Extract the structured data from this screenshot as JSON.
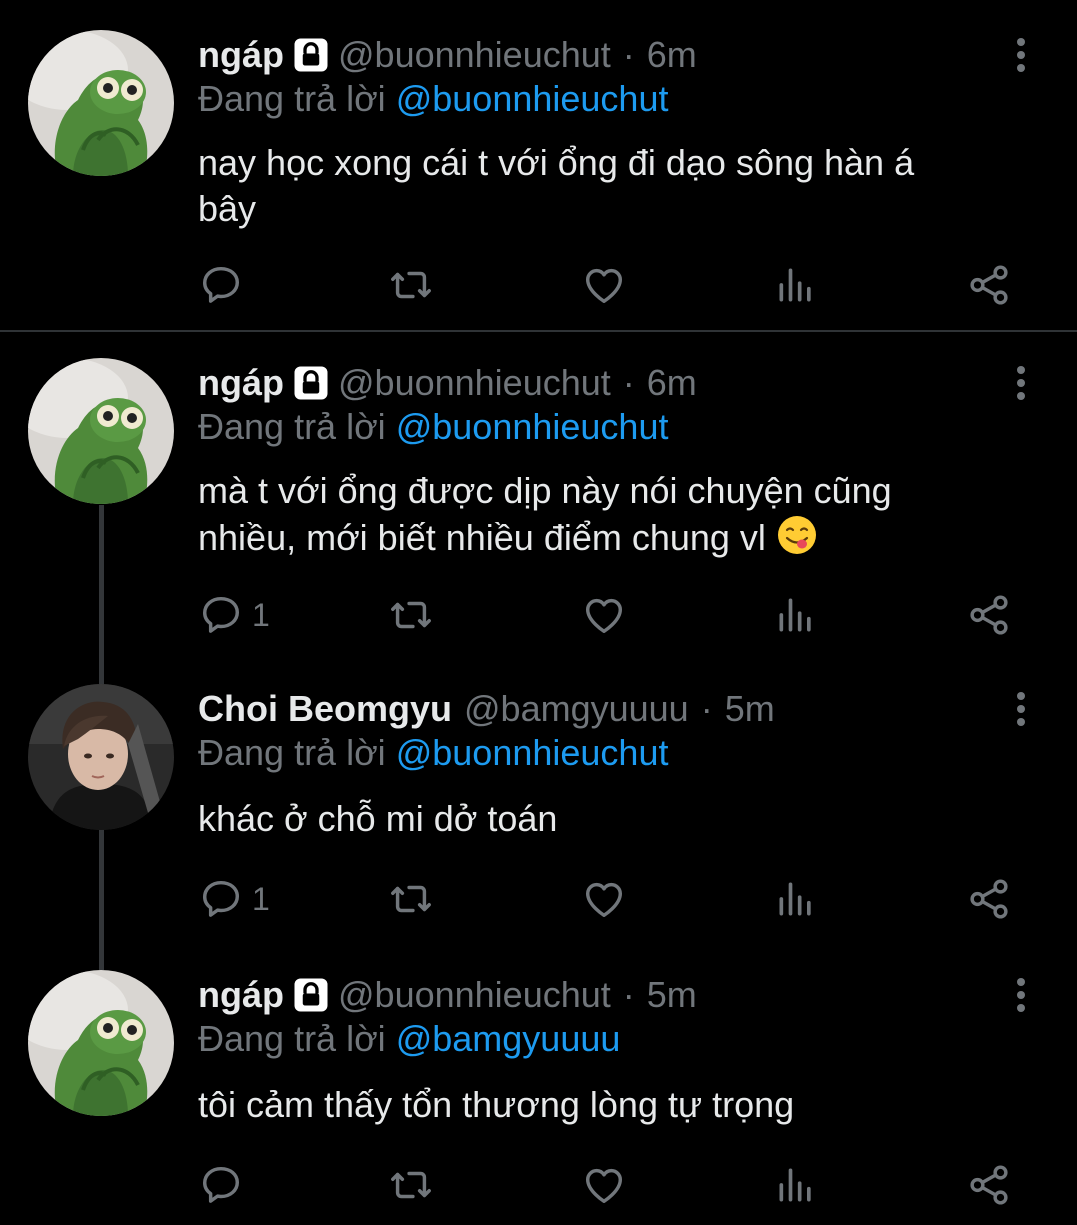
{
  "colors": {
    "background": "#000000",
    "text": "#e7e9ea",
    "secondary": "#71767b",
    "mention": "#1d9bf0",
    "divider": "#2f3336"
  },
  "tweets": [
    {
      "name": "ngáp",
      "locked": true,
      "handle": "@buonnhieuchut",
      "time": "6m",
      "sep": "·",
      "reply_prefix": "Đang trả lời",
      "reply_to": "@buonnhieuchut",
      "text_lines": [
        "nay học xong cái t với ổng đi dạo sông hàn á",
        "bây"
      ],
      "reply_count": "",
      "avatar": "frog-avatar"
    },
    {
      "name": "ngáp",
      "locked": true,
      "handle": "@buonnhieuchut",
      "time": "6m",
      "sep": "·",
      "reply_prefix": "Đang trả lời",
      "reply_to": "@buonnhieuchut",
      "text_lines": [
        "mà t với ổng được dịp này nói chuyện cũng",
        "nhiều, mới biết nhiều điểm chung vl"
      ],
      "emoji": "face-savoring-food-emoji",
      "reply_count": "1",
      "avatar": "frog-avatar"
    },
    {
      "name": "Choi Beomgyu",
      "locked": false,
      "handle": "@bamgyuuuu",
      "time": "5m",
      "sep": "·",
      "reply_prefix": "Đang trả lời",
      "reply_to": "@buonnhieuchut",
      "text_lines": [
        "khác ở chỗ mi dở toán"
      ],
      "reply_count": "1",
      "avatar": "person-avatar"
    },
    {
      "name": "ngáp",
      "locked": true,
      "handle": "@buonnhieuchut",
      "time": "5m",
      "sep": "·",
      "reply_prefix": "Đang trả lời",
      "reply_to": "@bamgyuuuu",
      "text_lines": [
        "tôi cảm thấy tổn thương lòng tự trọng"
      ],
      "reply_count": "",
      "avatar": "frog-avatar"
    }
  ]
}
